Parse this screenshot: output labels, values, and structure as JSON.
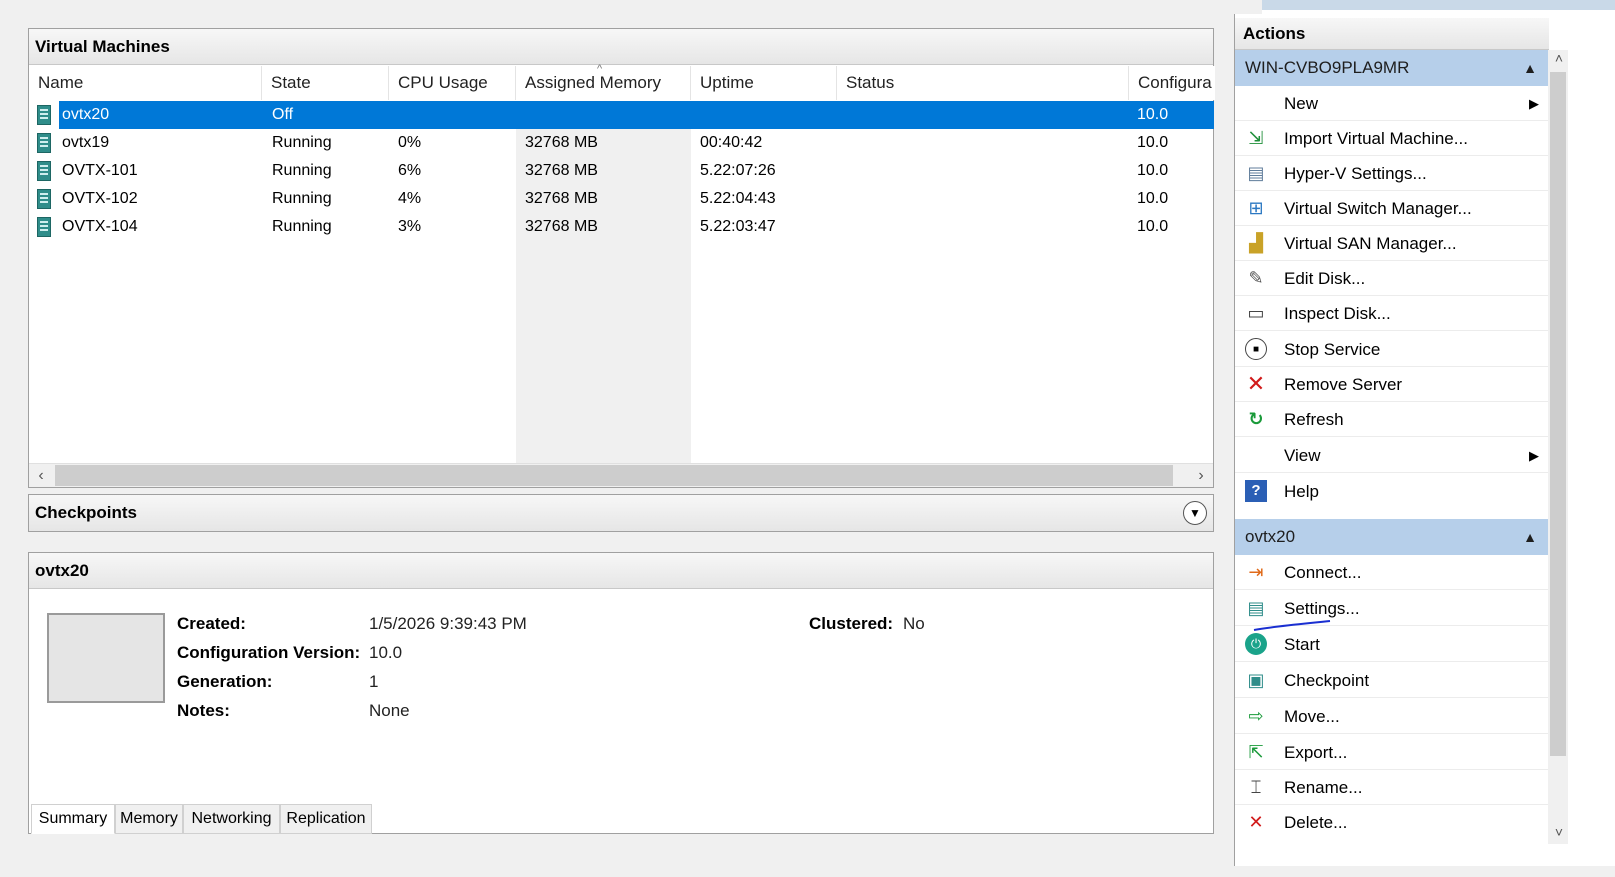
{
  "vm_panel": {
    "title": "Virtual Machines",
    "columns": [
      "Name",
      "State",
      "CPU Usage",
      "Assigned Memory",
      "Uptime",
      "Status",
      "Configura"
    ],
    "rows": [
      {
        "name": "ovtx20",
        "state": "Off",
        "cpu": "",
        "memory": "",
        "uptime": "",
        "status": "",
        "config": "10.0",
        "selected": true
      },
      {
        "name": "ovtx19",
        "state": "Running",
        "cpu": "0%",
        "memory": "32768 MB",
        "uptime": "00:40:42",
        "status": "",
        "config": "10.0"
      },
      {
        "name": "OVTX-101",
        "state": "Running",
        "cpu": "6%",
        "memory": "32768 MB",
        "uptime": "5.22:07:26",
        "status": "",
        "config": "10.0"
      },
      {
        "name": "OVTX-102",
        "state": "Running",
        "cpu": "4%",
        "memory": "32768 MB",
        "uptime": "5.22:04:43",
        "status": "",
        "config": "10.0"
      },
      {
        "name": "OVTX-104",
        "state": "Running",
        "cpu": "3%",
        "memory": "32768 MB",
        "uptime": "5.22:03:47",
        "status": "",
        "config": "10.0"
      }
    ]
  },
  "checkpoints": {
    "title": "Checkpoints"
  },
  "details": {
    "title": "ovtx20",
    "created_label": "Created:",
    "created_value": "1/5/2026 9:39:43 PM",
    "config_label": "Configuration Version:",
    "config_value": "10.0",
    "generation_label": "Generation:",
    "generation_value": "1",
    "notes_label": "Notes:",
    "notes_value": "None",
    "clustered_label": "Clustered:",
    "clustered_value": "No",
    "tabs": [
      "Summary",
      "Memory",
      "Networking",
      "Replication"
    ],
    "active_tab": "Summary"
  },
  "actions": {
    "title": "Actions",
    "server_group": "WIN-CVBO9PLA9MR",
    "server_items": [
      {
        "label": "New",
        "icon": "blank-icon",
        "submenu": true
      },
      {
        "label": "Import Virtual Machine...",
        "icon": "import-icon"
      },
      {
        "label": "Hyper-V Settings...",
        "icon": "settings-doc-icon"
      },
      {
        "label": "Virtual Switch Manager...",
        "icon": "switch-icon"
      },
      {
        "label": "Virtual SAN Manager...",
        "icon": "san-icon"
      },
      {
        "label": "Edit Disk...",
        "icon": "edit-disk-icon"
      },
      {
        "label": "Inspect Disk...",
        "icon": "inspect-disk-icon"
      },
      {
        "label": "Stop Service",
        "icon": "stop-icon"
      },
      {
        "label": "Remove Server",
        "icon": "remove-x-icon"
      },
      {
        "label": "Refresh",
        "icon": "refresh-icon"
      },
      {
        "label": "View",
        "icon": "blank-icon",
        "submenu": true
      },
      {
        "label": "Help",
        "icon": "help-icon"
      }
    ],
    "vm_group": "ovtx20",
    "vm_items": [
      {
        "label": "Connect...",
        "icon": "connect-icon"
      },
      {
        "label": "Settings...",
        "icon": "vm-settings-icon"
      },
      {
        "label": "Start",
        "icon": "power-icon"
      },
      {
        "label": "Checkpoint",
        "icon": "checkpoint-icon"
      },
      {
        "label": "Move...",
        "icon": "move-icon"
      },
      {
        "label": "Export...",
        "icon": "export-icon"
      },
      {
        "label": "Rename...",
        "icon": "rename-icon"
      },
      {
        "label": "Delete...",
        "icon": "delete-icon"
      }
    ]
  },
  "colors": {
    "selection": "#0078d7",
    "group_header": "#b6cfea",
    "vm_icon": "#2f8d8a"
  }
}
